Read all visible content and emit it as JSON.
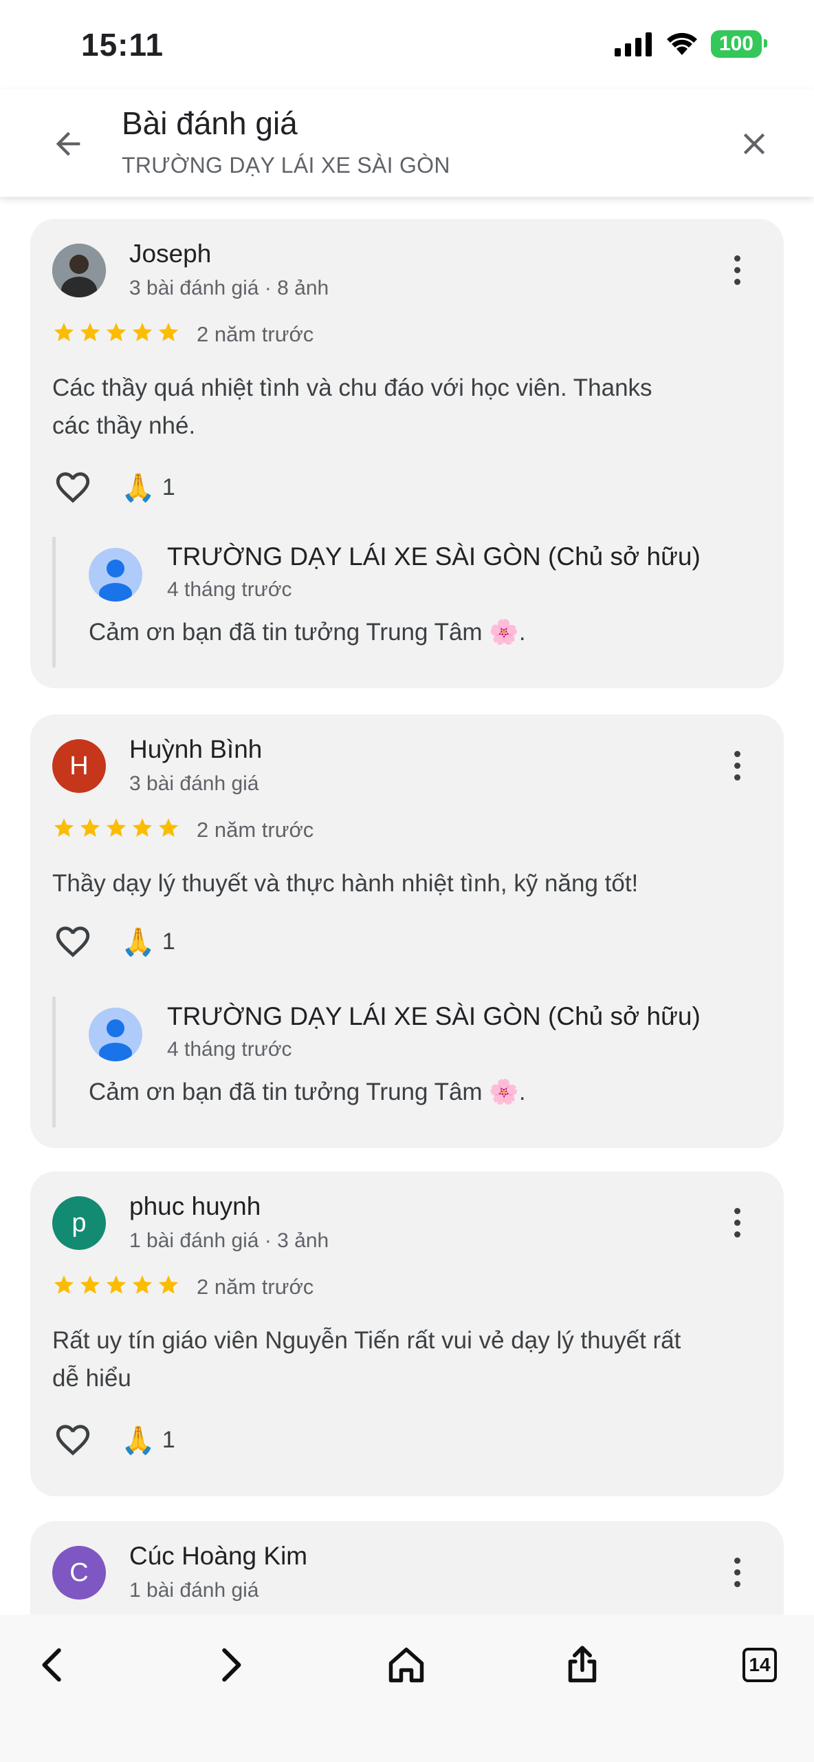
{
  "status": {
    "time": "15:11",
    "battery": "100"
  },
  "header": {
    "title": "Bài đánh giá",
    "subtitle": "TRƯỜNG DẠY LÁI XE SÀI GÒN"
  },
  "reviews": [
    {
      "author": "Joseph",
      "meta": "3 bài đánh giá · 8 ảnh",
      "rating": 5,
      "time": "2 năm trước",
      "text_line1": "Các thầy quá nhiệt tình và chu đáo với học viên. Thanks",
      "text_line2": "các thầy nhé.",
      "reaction_count": "1",
      "reply": {
        "name": "TRƯỜNG DẠY LÁI XE SÀI GÒN (Chủ sở hữu)",
        "time": "4 tháng trước",
        "text": "Cảm ơn bạn đã tin tưởng Trung Tâm 🌸."
      }
    },
    {
      "author": "Huỳnh Bình",
      "initial": "H",
      "meta": "3 bài đánh giá",
      "rating": 5,
      "time": "2 năm trước",
      "text_line1": "Thầy dạy lý thuyết và thực hành nhiệt tình, kỹ năng tốt!",
      "reaction_count": "1",
      "reply": {
        "name": "TRƯỜNG DẠY LÁI XE SÀI GÒN (Chủ sở hữu)",
        "time": "4 tháng trước",
        "text": "Cảm ơn bạn đã tin tưởng Trung Tâm 🌸."
      }
    },
    {
      "author": "phuc huynh",
      "initial": "p",
      "meta": "1 bài đánh giá · 3 ảnh",
      "rating": 5,
      "time": "2 năm trước",
      "text_line1": "Rất uy tín giáo viên Nguyễn Tiến rất vui vẻ dạy lý thuyết rất",
      "text_line2": "dễ hiểu",
      "reaction_count": "1"
    },
    {
      "author": "Cúc Hoàng Kim",
      "initial": "C",
      "meta": "1 bài đánh giá"
    }
  ],
  "browser": {
    "tabs_count": "14"
  },
  "colors": {
    "star": "#fbbc04",
    "avatar_h": "#c5361b",
    "avatar_p": "#138a72",
    "avatar_c": "#7e57c2",
    "battery": "#34c759"
  }
}
